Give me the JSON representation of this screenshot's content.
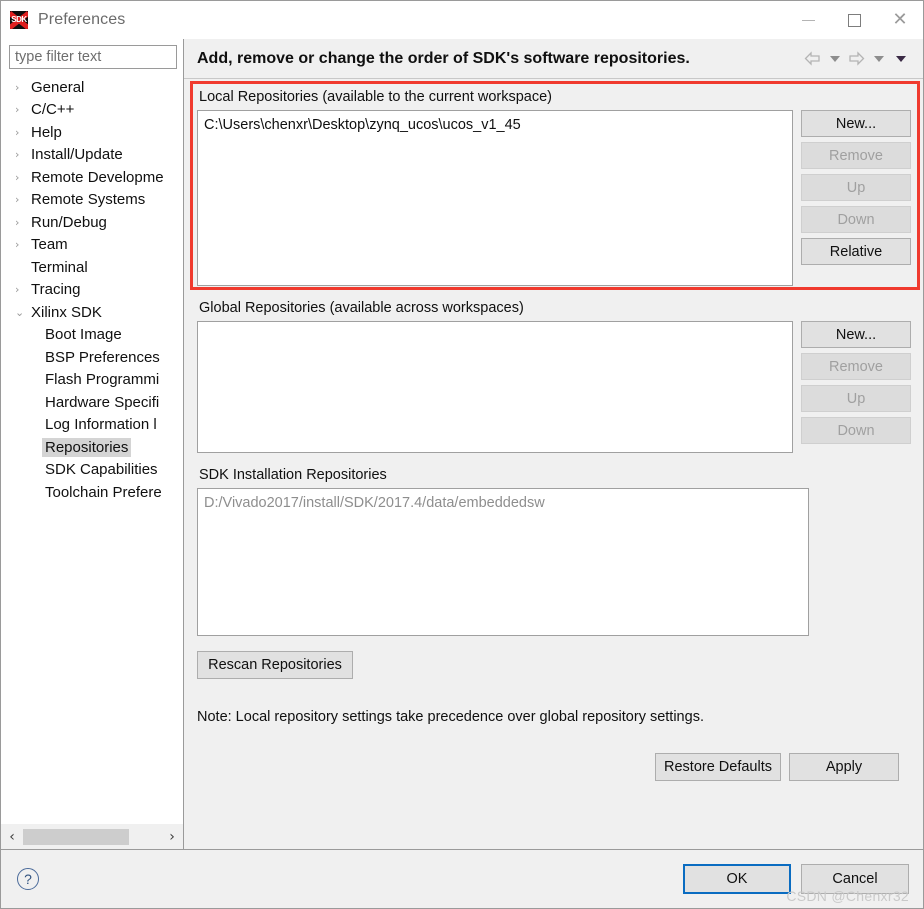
{
  "window": {
    "title": "Preferences",
    "icon": "sdk-icon",
    "icon_text": "SDK",
    "controls": {
      "minimize": "Minimize",
      "maximize": "Maximize",
      "close": "Close"
    }
  },
  "sidebar": {
    "filter": {
      "placeholder": "type filter text",
      "value": ""
    },
    "tree": [
      {
        "label": "General",
        "level": 1,
        "arrow": "›",
        "selected": false
      },
      {
        "label": "C/C++",
        "level": 1,
        "arrow": "›",
        "selected": false
      },
      {
        "label": "Help",
        "level": 1,
        "arrow": "›",
        "selected": false
      },
      {
        "label": "Install/Update",
        "level": 1,
        "arrow": "›",
        "selected": false
      },
      {
        "label": "Remote Developme",
        "level": 1,
        "arrow": "›",
        "selected": false
      },
      {
        "label": "Remote Systems",
        "level": 1,
        "arrow": "›",
        "selected": false
      },
      {
        "label": "Run/Debug",
        "level": 1,
        "arrow": "›",
        "selected": false
      },
      {
        "label": "Team",
        "level": 1,
        "arrow": "›",
        "selected": false
      },
      {
        "label": "Terminal",
        "level": 1,
        "arrow": "",
        "selected": false
      },
      {
        "label": "Tracing",
        "level": 1,
        "arrow": "›",
        "selected": false
      },
      {
        "label": "Xilinx SDK",
        "level": 1,
        "arrow": "⌄",
        "selected": false
      },
      {
        "label": "Boot Image",
        "level": 2,
        "arrow": "",
        "selected": false
      },
      {
        "label": "BSP Preferences",
        "level": 2,
        "arrow": "",
        "selected": false
      },
      {
        "label": "Flash Programmi",
        "level": 2,
        "arrow": "",
        "selected": false
      },
      {
        "label": "Hardware Specifi",
        "level": 2,
        "arrow": "",
        "selected": false
      },
      {
        "label": "Log Information l",
        "level": 2,
        "arrow": "",
        "selected": false
      },
      {
        "label": "Repositories",
        "level": 2,
        "arrow": "",
        "selected": true
      },
      {
        "label": "SDK Capabilities",
        "level": 2,
        "arrow": "",
        "selected": false
      },
      {
        "label": "Toolchain Prefere",
        "level": 2,
        "arrow": "",
        "selected": false
      }
    ],
    "hscroll": {
      "left_arrow": "‹",
      "right_arrow": "›"
    }
  },
  "header": {
    "title": "Add, remove or change the order of SDK's software repositories.",
    "nav": {
      "back": "⇦",
      "back_menu": "back-dropdown",
      "forward": "⇨",
      "forward_menu": "forward-dropdown",
      "view_menu": "view-menu"
    }
  },
  "local": {
    "label": "Local Repositories (available to the current workspace)",
    "items": [
      "C:\\Users\\chenxr\\Desktop\\zynq_ucos\\ucos_v1_45"
    ],
    "buttons": [
      {
        "label": "New...",
        "enabled": true
      },
      {
        "label": "Remove",
        "enabled": false
      },
      {
        "label": "Up",
        "enabled": false
      },
      {
        "label": "Down",
        "enabled": false
      },
      {
        "label": "Relative",
        "enabled": true
      }
    ],
    "highlight_color": "#f03a2e"
  },
  "global": {
    "label": "Global Repositories (available across workspaces)",
    "items": [],
    "buttons": [
      {
        "label": "New...",
        "enabled": true
      },
      {
        "label": "Remove",
        "enabled": false
      },
      {
        "label": "Up",
        "enabled": false
      },
      {
        "label": "Down",
        "enabled": false
      }
    ]
  },
  "installation": {
    "label": "SDK Installation Repositories",
    "items": [
      "D:/Vivado2017/install/SDK/2017.4/data/embeddedsw"
    ]
  },
  "rescan": {
    "label": "Rescan Repositories"
  },
  "note": "Note: Local repository settings take precedence over global repository settings.",
  "page_buttons": {
    "restore_defaults": "Restore Defaults",
    "apply": "Apply"
  },
  "footer": {
    "help": "?",
    "ok": "OK",
    "cancel": "Cancel",
    "watermark": "CSDN @Chenxr32",
    "focus_color": "#0a6cc1"
  }
}
